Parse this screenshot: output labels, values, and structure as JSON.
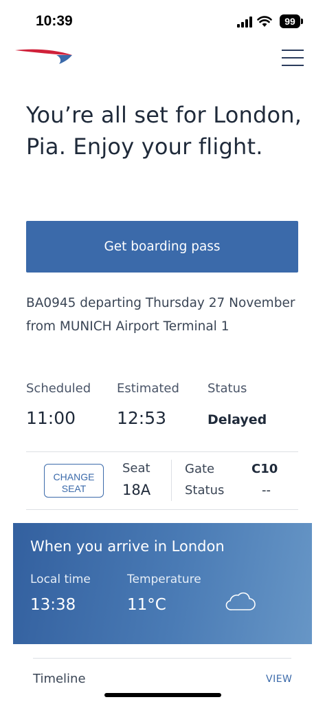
{
  "status_bar": {
    "time": "10:39",
    "battery": "99"
  },
  "header": {
    "logo_icon": "british-airways-speedmarque-icon",
    "menu_icon": "hamburger-menu-icon"
  },
  "headline": "You’re all set for London, Pia. Enjoy your flight.",
  "cta": {
    "label": "Get boarding pass"
  },
  "flight": {
    "description": "BA0945 departing Thursday 27 November from MUNICH Airport Terminal 1",
    "scheduled_label": "Scheduled",
    "scheduled_value": "11:00",
    "estimated_label": "Estimated",
    "estimated_value": "12:53",
    "status_label": "Status",
    "status_value": "Delayed"
  },
  "seat_gate": {
    "change_seat_label": "CHANGE SEAT",
    "seat_label": "Seat",
    "seat_value": "18A",
    "gate_label": "Gate",
    "gate_value": "C10",
    "gate_status_label": "Status",
    "gate_status_value": "--"
  },
  "arrival": {
    "title": "When you arrive in London",
    "local_time_label": "Local time",
    "local_time_value": "13:38",
    "temperature_label": "Temperature",
    "temperature_value": "11°C",
    "weather_icon": "cloud-icon"
  },
  "timeline": {
    "label": "Timeline",
    "action": "VIEW"
  },
  "colors": {
    "brand_blue": "#3b6aaa",
    "brand_red": "#d0213a",
    "text_dark": "#1f2a3a"
  }
}
